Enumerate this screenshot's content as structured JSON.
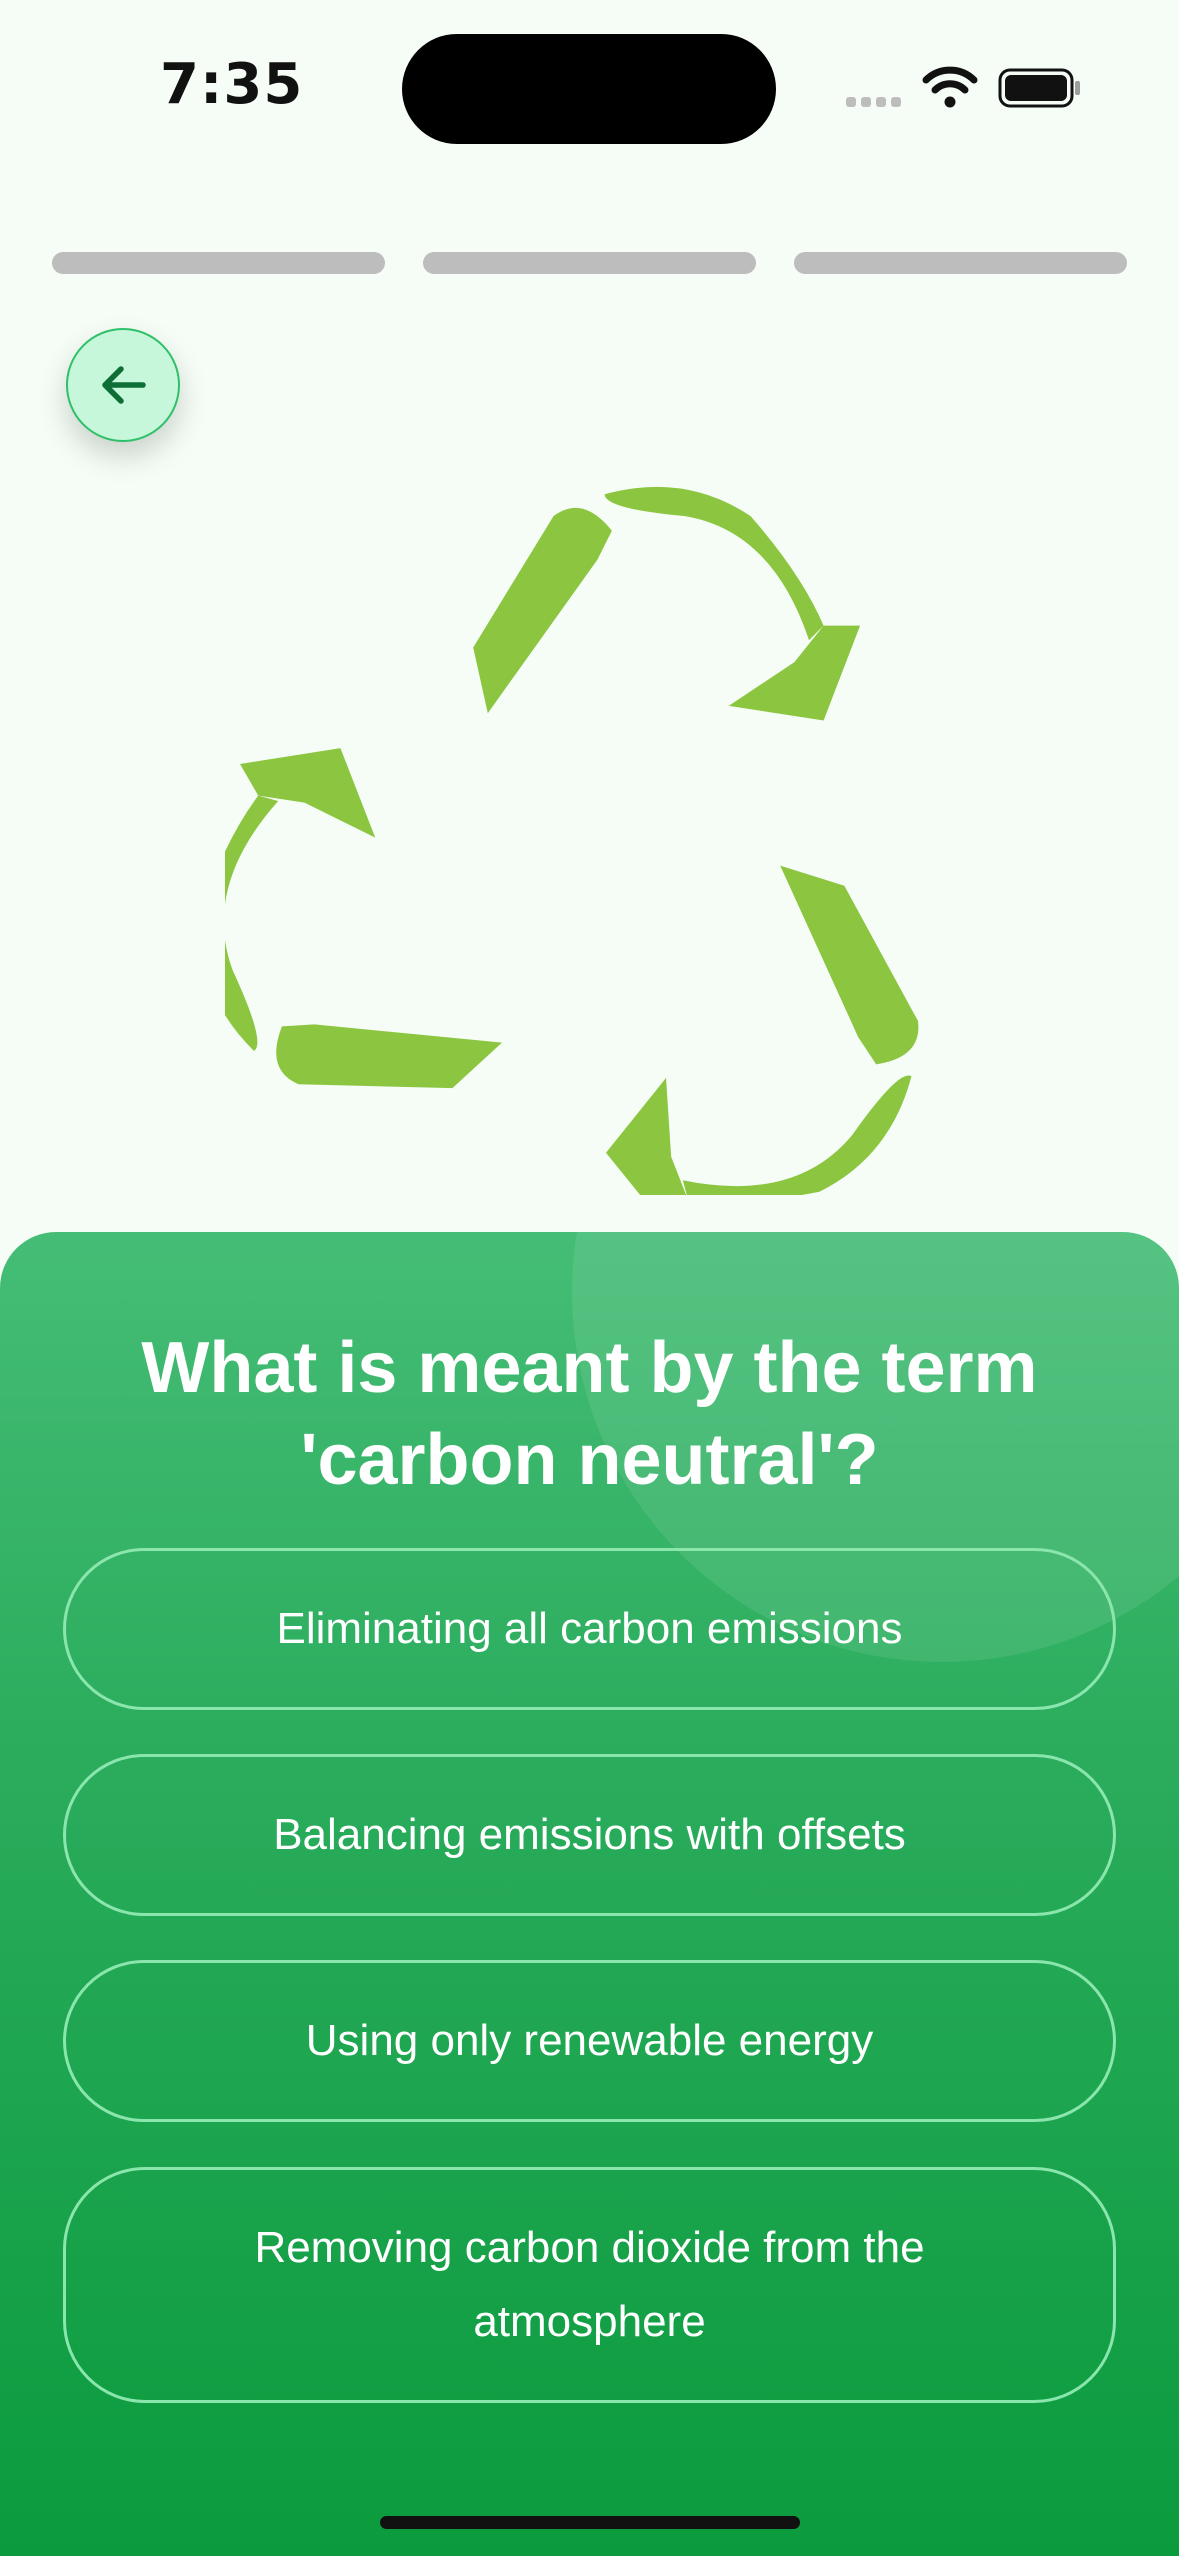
{
  "status_bar": {
    "time": "7:35"
  },
  "progress": {
    "segments": 3
  },
  "question": {
    "text": "What is meant by the term 'carbon neutral'?"
  },
  "options": [
    {
      "label": "Eliminating all carbon emissions"
    },
    {
      "label": "Balancing emissions with offsets"
    },
    {
      "label": "Using only renewable energy"
    },
    {
      "label": "Removing carbon dioxide from the atmosphere"
    }
  ],
  "icons": {
    "back": "arrow-left-icon",
    "hero": "recycle-icon",
    "wifi": "wifi-icon",
    "battery": "battery-icon"
  },
  "colors": {
    "accent": "#8cc641",
    "sheet_top": "#45bd76",
    "sheet_bottom": "#0b9b3d",
    "option_border": "#8ae6ad"
  }
}
